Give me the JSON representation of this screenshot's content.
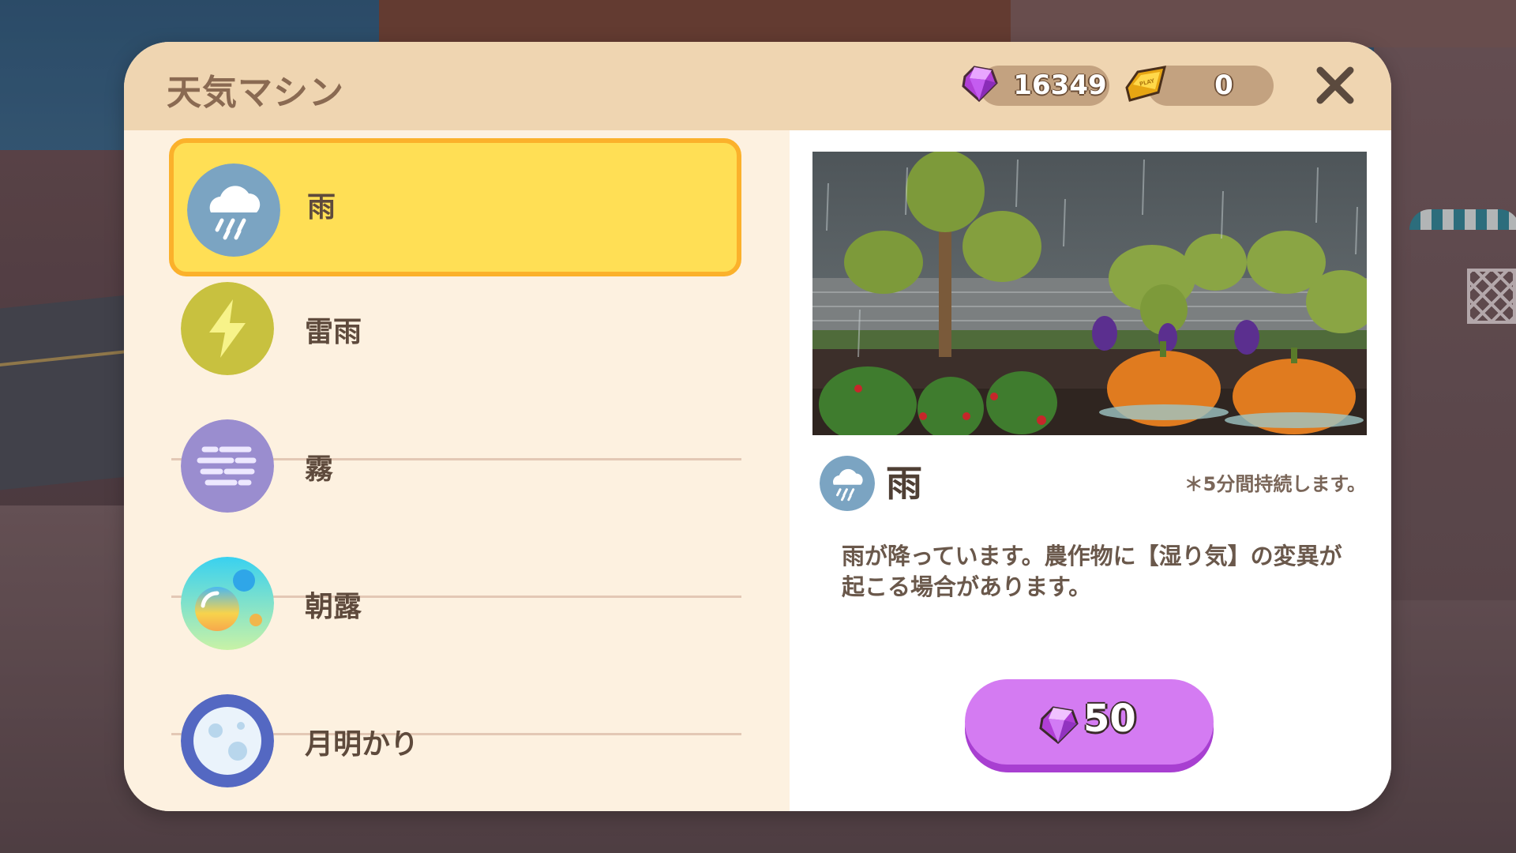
{
  "window": {
    "title": "天気マシン",
    "close_icon": "close-icon"
  },
  "currency": {
    "gems": "16349",
    "gold": "0",
    "gem_icon": "gem-icon",
    "gold_icon": "gold-bar-icon",
    "gold_stamp": "PLAY"
  },
  "weather_list": [
    {
      "label": "雨",
      "icon": "rain-cloud-icon",
      "color": "#7ba4c2",
      "selected": true
    },
    {
      "label": "雷雨",
      "icon": "lightning-icon",
      "color": "#c8c13f",
      "selected": false
    },
    {
      "label": "霧",
      "icon": "fog-icon",
      "color": "#9a8dcf",
      "selected": false
    },
    {
      "label": "朝露",
      "icon": "dewdrop-icon",
      "color": "#4fd7e2",
      "selected": false
    },
    {
      "label": "月明かり",
      "icon": "moon-icon",
      "color": "#5468c2",
      "selected": false
    }
  ],
  "detail": {
    "name": "雨",
    "icon": "rain-cloud-icon",
    "duration": "＊5分間持続します。",
    "description": "雨が降っています。農作物に【湿り気】の変異が起こる場合があります。",
    "price": "50",
    "price_icon": "gem-icon",
    "preview": "rainy-garden-preview"
  },
  "colors": {
    "header_bg": "#efd5b1",
    "list_bg": "#fdf1e0",
    "selected_bg": "#ffdf55",
    "selected_border": "#fbb12b",
    "buy_button": "#d47bf2"
  }
}
